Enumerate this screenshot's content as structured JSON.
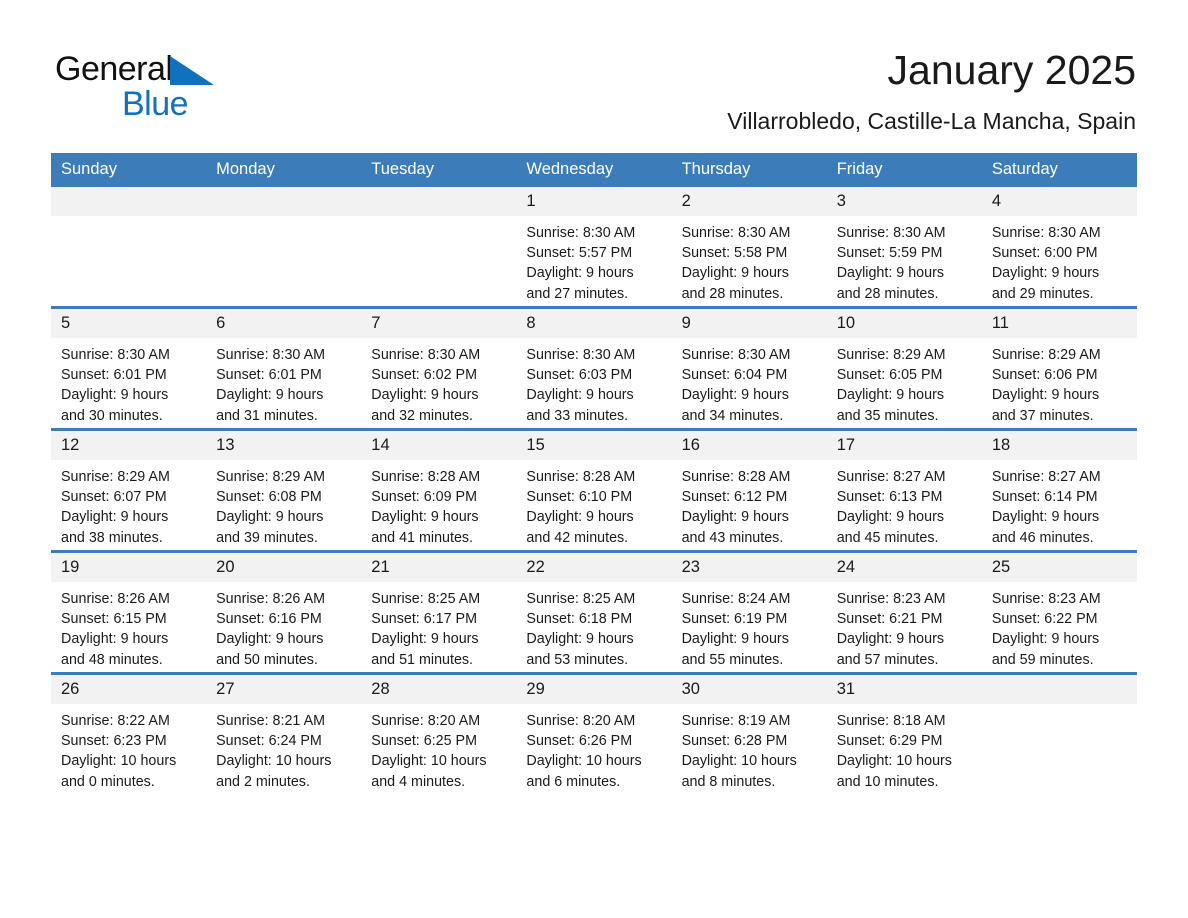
{
  "brand": {
    "name_part1": "General",
    "name_part2": "Blue",
    "logo_icon": "triangle-flag-icon",
    "accent_color": "#1271bd"
  },
  "header": {
    "title": "January 2025",
    "subtitle": "Villarrobledo, Castille-La Mancha, Spain"
  },
  "calendar": {
    "header_bg_color": "#3c7cb8",
    "daynum_bg_color": "#f2f2f2",
    "weekday_headers": [
      "Sunday",
      "Monday",
      "Tuesday",
      "Wednesday",
      "Thursday",
      "Friday",
      "Saturday"
    ],
    "weeks": [
      [
        {
          "day": "",
          "empty": true,
          "sunrise": "",
          "sunset": "",
          "daylight_line1": "",
          "daylight_line2": ""
        },
        {
          "day": "",
          "empty": true,
          "sunrise": "",
          "sunset": "",
          "daylight_line1": "",
          "daylight_line2": ""
        },
        {
          "day": "",
          "empty": true,
          "sunrise": "",
          "sunset": "",
          "daylight_line1": "",
          "daylight_line2": ""
        },
        {
          "day": "1",
          "empty": false,
          "sunrise": "Sunrise: 8:30 AM",
          "sunset": "Sunset: 5:57 PM",
          "daylight_line1": "Daylight: 9 hours",
          "daylight_line2": "and 27 minutes."
        },
        {
          "day": "2",
          "empty": false,
          "sunrise": "Sunrise: 8:30 AM",
          "sunset": "Sunset: 5:58 PM",
          "daylight_line1": "Daylight: 9 hours",
          "daylight_line2": "and 28 minutes."
        },
        {
          "day": "3",
          "empty": false,
          "sunrise": "Sunrise: 8:30 AM",
          "sunset": "Sunset: 5:59 PM",
          "daylight_line1": "Daylight: 9 hours",
          "daylight_line2": "and 28 minutes."
        },
        {
          "day": "4",
          "empty": false,
          "sunrise": "Sunrise: 8:30 AM",
          "sunset": "Sunset: 6:00 PM",
          "daylight_line1": "Daylight: 9 hours",
          "daylight_line2": "and 29 minutes."
        }
      ],
      [
        {
          "day": "5",
          "empty": false,
          "sunrise": "Sunrise: 8:30 AM",
          "sunset": "Sunset: 6:01 PM",
          "daylight_line1": "Daylight: 9 hours",
          "daylight_line2": "and 30 minutes."
        },
        {
          "day": "6",
          "empty": false,
          "sunrise": "Sunrise: 8:30 AM",
          "sunset": "Sunset: 6:01 PM",
          "daylight_line1": "Daylight: 9 hours",
          "daylight_line2": "and 31 minutes."
        },
        {
          "day": "7",
          "empty": false,
          "sunrise": "Sunrise: 8:30 AM",
          "sunset": "Sunset: 6:02 PM",
          "daylight_line1": "Daylight: 9 hours",
          "daylight_line2": "and 32 minutes."
        },
        {
          "day": "8",
          "empty": false,
          "sunrise": "Sunrise: 8:30 AM",
          "sunset": "Sunset: 6:03 PM",
          "daylight_line1": "Daylight: 9 hours",
          "daylight_line2": "and 33 minutes."
        },
        {
          "day": "9",
          "empty": false,
          "sunrise": "Sunrise: 8:30 AM",
          "sunset": "Sunset: 6:04 PM",
          "daylight_line1": "Daylight: 9 hours",
          "daylight_line2": "and 34 minutes."
        },
        {
          "day": "10",
          "empty": false,
          "sunrise": "Sunrise: 8:29 AM",
          "sunset": "Sunset: 6:05 PM",
          "daylight_line1": "Daylight: 9 hours",
          "daylight_line2": "and 35 minutes."
        },
        {
          "day": "11",
          "empty": false,
          "sunrise": "Sunrise: 8:29 AM",
          "sunset": "Sunset: 6:06 PM",
          "daylight_line1": "Daylight: 9 hours",
          "daylight_line2": "and 37 minutes."
        }
      ],
      [
        {
          "day": "12",
          "empty": false,
          "sunrise": "Sunrise: 8:29 AM",
          "sunset": "Sunset: 6:07 PM",
          "daylight_line1": "Daylight: 9 hours",
          "daylight_line2": "and 38 minutes."
        },
        {
          "day": "13",
          "empty": false,
          "sunrise": "Sunrise: 8:29 AM",
          "sunset": "Sunset: 6:08 PM",
          "daylight_line1": "Daylight: 9 hours",
          "daylight_line2": "and 39 minutes."
        },
        {
          "day": "14",
          "empty": false,
          "sunrise": "Sunrise: 8:28 AM",
          "sunset": "Sunset: 6:09 PM",
          "daylight_line1": "Daylight: 9 hours",
          "daylight_line2": "and 41 minutes."
        },
        {
          "day": "15",
          "empty": false,
          "sunrise": "Sunrise: 8:28 AM",
          "sunset": "Sunset: 6:10 PM",
          "daylight_line1": "Daylight: 9 hours",
          "daylight_line2": "and 42 minutes."
        },
        {
          "day": "16",
          "empty": false,
          "sunrise": "Sunrise: 8:28 AM",
          "sunset": "Sunset: 6:12 PM",
          "daylight_line1": "Daylight: 9 hours",
          "daylight_line2": "and 43 minutes."
        },
        {
          "day": "17",
          "empty": false,
          "sunrise": "Sunrise: 8:27 AM",
          "sunset": "Sunset: 6:13 PM",
          "daylight_line1": "Daylight: 9 hours",
          "daylight_line2": "and 45 minutes."
        },
        {
          "day": "18",
          "empty": false,
          "sunrise": "Sunrise: 8:27 AM",
          "sunset": "Sunset: 6:14 PM",
          "daylight_line1": "Daylight: 9 hours",
          "daylight_line2": "and 46 minutes."
        }
      ],
      [
        {
          "day": "19",
          "empty": false,
          "sunrise": "Sunrise: 8:26 AM",
          "sunset": "Sunset: 6:15 PM",
          "daylight_line1": "Daylight: 9 hours",
          "daylight_line2": "and 48 minutes."
        },
        {
          "day": "20",
          "empty": false,
          "sunrise": "Sunrise: 8:26 AM",
          "sunset": "Sunset: 6:16 PM",
          "daylight_line1": "Daylight: 9 hours",
          "daylight_line2": "and 50 minutes."
        },
        {
          "day": "21",
          "empty": false,
          "sunrise": "Sunrise: 8:25 AM",
          "sunset": "Sunset: 6:17 PM",
          "daylight_line1": "Daylight: 9 hours",
          "daylight_line2": "and 51 minutes."
        },
        {
          "day": "22",
          "empty": false,
          "sunrise": "Sunrise: 8:25 AM",
          "sunset": "Sunset: 6:18 PM",
          "daylight_line1": "Daylight: 9 hours",
          "daylight_line2": "and 53 minutes."
        },
        {
          "day": "23",
          "empty": false,
          "sunrise": "Sunrise: 8:24 AM",
          "sunset": "Sunset: 6:19 PM",
          "daylight_line1": "Daylight: 9 hours",
          "daylight_line2": "and 55 minutes."
        },
        {
          "day": "24",
          "empty": false,
          "sunrise": "Sunrise: 8:23 AM",
          "sunset": "Sunset: 6:21 PM",
          "daylight_line1": "Daylight: 9 hours",
          "daylight_line2": "and 57 minutes."
        },
        {
          "day": "25",
          "empty": false,
          "sunrise": "Sunrise: 8:23 AM",
          "sunset": "Sunset: 6:22 PM",
          "daylight_line1": "Daylight: 9 hours",
          "daylight_line2": "and 59 minutes."
        }
      ],
      [
        {
          "day": "26",
          "empty": false,
          "sunrise": "Sunrise: 8:22 AM",
          "sunset": "Sunset: 6:23 PM",
          "daylight_line1": "Daylight: 10 hours",
          "daylight_line2": "and 0 minutes."
        },
        {
          "day": "27",
          "empty": false,
          "sunrise": "Sunrise: 8:21 AM",
          "sunset": "Sunset: 6:24 PM",
          "daylight_line1": "Daylight: 10 hours",
          "daylight_line2": "and 2 minutes."
        },
        {
          "day": "28",
          "empty": false,
          "sunrise": "Sunrise: 8:20 AM",
          "sunset": "Sunset: 6:25 PM",
          "daylight_line1": "Daylight: 10 hours",
          "daylight_line2": "and 4 minutes."
        },
        {
          "day": "29",
          "empty": false,
          "sunrise": "Sunrise: 8:20 AM",
          "sunset": "Sunset: 6:26 PM",
          "daylight_line1": "Daylight: 10 hours",
          "daylight_line2": "and 6 minutes."
        },
        {
          "day": "30",
          "empty": false,
          "sunrise": "Sunrise: 8:19 AM",
          "sunset": "Sunset: 6:28 PM",
          "daylight_line1": "Daylight: 10 hours",
          "daylight_line2": "and 8 minutes."
        },
        {
          "day": "31",
          "empty": false,
          "sunrise": "Sunrise: 8:18 AM",
          "sunset": "Sunset: 6:29 PM",
          "daylight_line1": "Daylight: 10 hours",
          "daylight_line2": "and 10 minutes."
        },
        {
          "day": "",
          "empty": true,
          "sunrise": "",
          "sunset": "",
          "daylight_line1": "",
          "daylight_line2": ""
        }
      ]
    ]
  }
}
